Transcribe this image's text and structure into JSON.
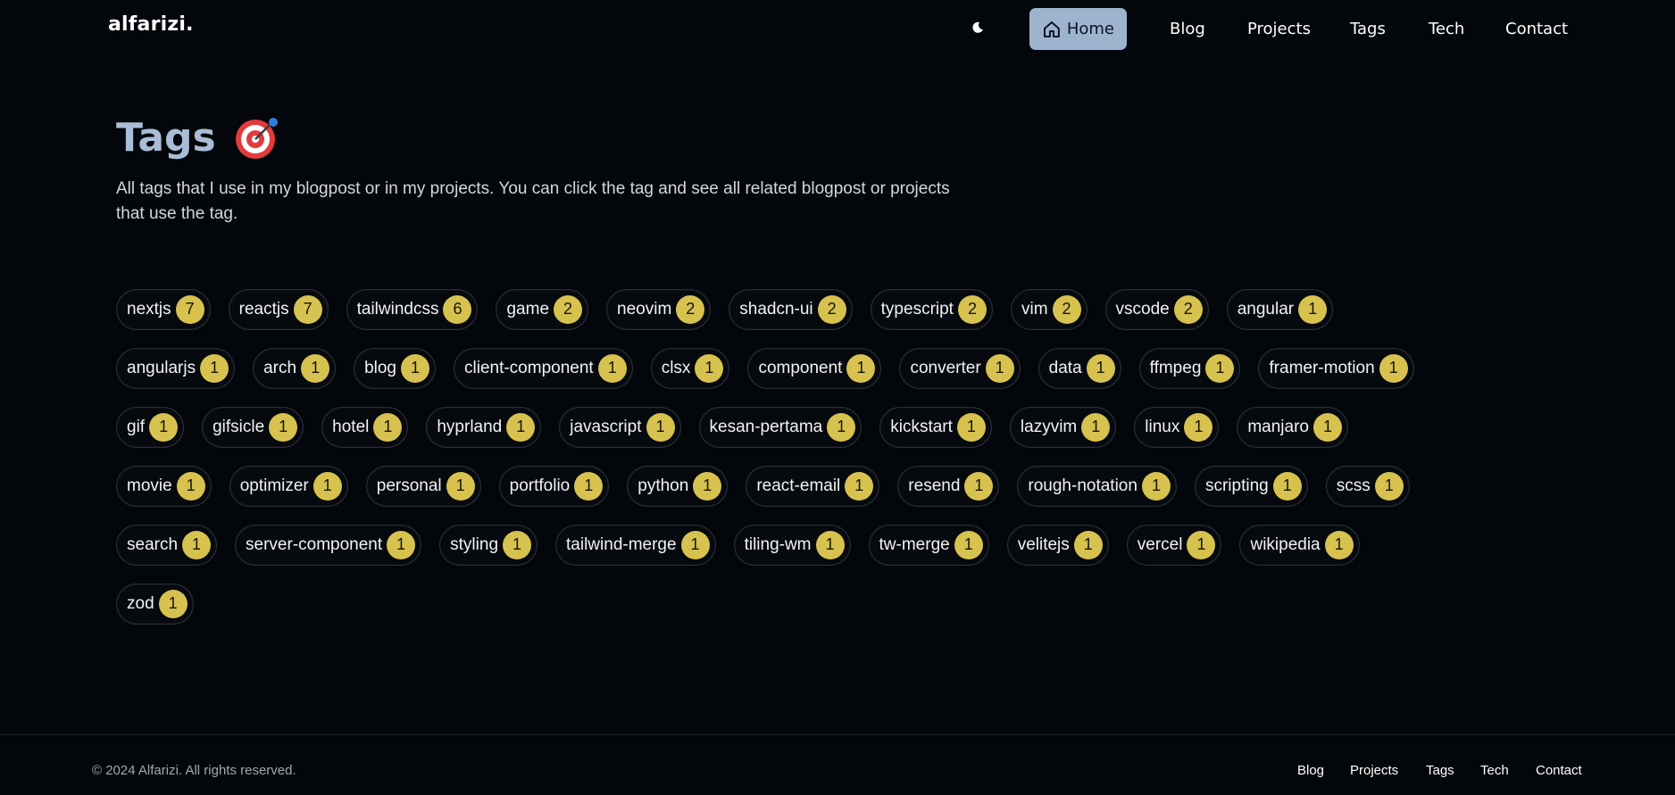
{
  "header": {
    "logo": "alfarizi.",
    "nav": [
      {
        "label": "Home",
        "active": true
      },
      {
        "label": "Blog",
        "active": false
      },
      {
        "label": "Projects",
        "active": false
      },
      {
        "label": "Tags",
        "active": false
      },
      {
        "label": "Tech",
        "active": false
      },
      {
        "label": "Contact",
        "active": false
      }
    ],
    "icons": {
      "theme_toggle": "moon-icon",
      "home": "home-icon"
    }
  },
  "main": {
    "title": "Tags",
    "title_emoji": "target-icon",
    "intro": "All tags that I use in my blogpost or in my projects. You can click the tag and see all related blogpost or projects that use the tag.",
    "tag_rows": [
      [
        {
          "label": "nextjs",
          "count": "7"
        },
        {
          "label": "reactjs",
          "count": "7"
        },
        {
          "label": "tailwindcss",
          "count": "6"
        },
        {
          "label": "game",
          "count": "2"
        },
        {
          "label": "neovim",
          "count": "2"
        },
        {
          "label": "shadcn-ui",
          "count": "2"
        },
        {
          "label": "typescript",
          "count": "2"
        },
        {
          "label": "vim",
          "count": "2"
        },
        {
          "label": "vscode",
          "count": "2"
        },
        {
          "label": "angular",
          "count": "1"
        }
      ],
      [
        {
          "label": "angularjs",
          "count": "1"
        },
        {
          "label": "arch",
          "count": "1"
        },
        {
          "label": "blog",
          "count": "1"
        },
        {
          "label": "client-component",
          "count": "1"
        },
        {
          "label": "clsx",
          "count": "1"
        },
        {
          "label": "component",
          "count": "1"
        },
        {
          "label": "converter",
          "count": "1"
        },
        {
          "label": "data",
          "count": "1"
        },
        {
          "label": "ffmpeg",
          "count": "1"
        },
        {
          "label": "framer-motion",
          "count": "1"
        }
      ],
      [
        {
          "label": "gif",
          "count": "1"
        },
        {
          "label": "gifsicle",
          "count": "1"
        },
        {
          "label": "hotel",
          "count": "1"
        },
        {
          "label": "hyprland",
          "count": "1"
        },
        {
          "label": "javascript",
          "count": "1"
        },
        {
          "label": "kesan-pertama",
          "count": "1"
        },
        {
          "label": "kickstart",
          "count": "1"
        },
        {
          "label": "lazyvim",
          "count": "1"
        },
        {
          "label": "linux",
          "count": "1"
        },
        {
          "label": "manjaro",
          "count": "1"
        }
      ],
      [
        {
          "label": "movie",
          "count": "1"
        },
        {
          "label": "optimizer",
          "count": "1"
        },
        {
          "label": "personal",
          "count": "1"
        },
        {
          "label": "portfolio",
          "count": "1"
        },
        {
          "label": "python",
          "count": "1"
        },
        {
          "label": "react-email",
          "count": "1"
        },
        {
          "label": "resend",
          "count": "1"
        },
        {
          "label": "rough-notation",
          "count": "1"
        },
        {
          "label": "scripting",
          "count": "1"
        },
        {
          "label": "scss",
          "count": "1"
        }
      ],
      [
        {
          "label": "search",
          "count": "1"
        },
        {
          "label": "server-component",
          "count": "1"
        },
        {
          "label": "styling",
          "count": "1"
        },
        {
          "label": "tailwind-merge",
          "count": "1"
        },
        {
          "label": "tiling-wm",
          "count": "1"
        },
        {
          "label": "tw-merge",
          "count": "1"
        },
        {
          "label": "velitejs",
          "count": "1"
        },
        {
          "label": "vercel",
          "count": "1"
        },
        {
          "label": "wikipedia",
          "count": "1"
        }
      ],
      [
        {
          "label": "zod",
          "count": "1"
        }
      ]
    ]
  },
  "footer": {
    "copyright": "© 2024 Alfarizi. All rights reserved.",
    "links": [
      "Blog",
      "Projects",
      "Tags",
      "Tech",
      "Contact"
    ]
  },
  "colors": {
    "background": "#03060a",
    "active_nav": "#9db4cf",
    "title": "#a9bdd6",
    "count_badge": "#d7c24f"
  }
}
